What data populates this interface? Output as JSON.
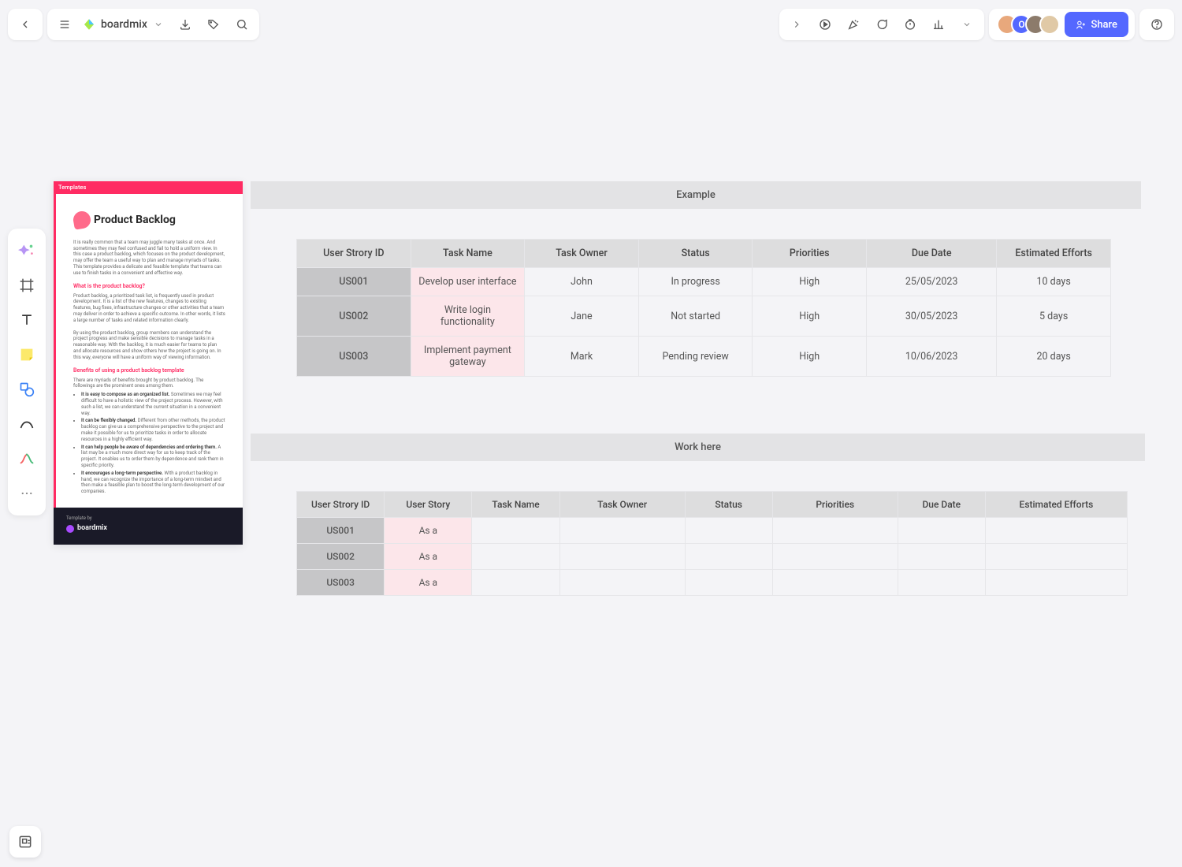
{
  "header": {
    "brand": "boardmix",
    "share": "Share"
  },
  "template": {
    "tag": "Templates",
    "title": "Product Backlog",
    "intro": "It is really common that a team may juggle many tasks at once. And sometimes they may feel confused and fail to hold a uniform view. In this case a product backlog, which focuses on the product development, may offer the team a useful way to plan and manage myriads of tasks. This template provides a delicate and feasible template that teams can use to finish tasks in a convenient and effective way.",
    "h1": "What is the product backlog?",
    "p1": "Product backlog, a prioritized task list, is frequently used in product development. It is a list of the new features, changes to existing features, bug fixes, infrastructure changes or other activities that a team may deliver in order to achieve a specific outcome. In other words, it lists a large number of tasks and related information clearly.",
    "p2": "By using the product backlog, group members can understand the project progress and make sensible decisions to manage tasks in a reasonable way. With the backlog, it is much easier for teams to plan and allocate resources and show others how the project is going on. In this way, everyone will have a uniform way of viewing information.",
    "h2": "Benefits of using a product backlog template",
    "p3": "There are myriads of benefits brought by product backlog. The followings are the prominent ones among them.",
    "li1b": "It is easy to compose as an organized list.",
    "li1": " Sometimes we may feel difficult to have a holistic view of the project process. However, with such a list, we can understand the current situation in a convenient way.",
    "li2b": "It can be flexibly changed.",
    "li2": " Different from other methods, the product backlog can give us a comprehensive perspective to the project and make it possible for us to prioritize tasks in order to allocate resources in a highly efficient way.",
    "li3b": "It can help people be aware of dependencies and ordering them.",
    "li3": " A list may be a much more direct way for us to keep track of the project. It enables us to order them by dependence and rank them in specific priority.",
    "li4b": "It encourages a long-term perspective.",
    "li4": " With a product backlog in hand, we can recognize the importance of a long-term mindset and then make a feasible plan to boost the long-term development of our companies.",
    "footer_by": "Template by",
    "footer_brand": "boardmix"
  },
  "example": {
    "title": "Example",
    "headers": [
      "User Strory ID",
      "Task Name",
      "Task Owner",
      "Status",
      "Priorities",
      "Due Date",
      "Estimated Efforts"
    ],
    "rows": [
      {
        "id": "US001",
        "task": "Develop user interface",
        "owner": "John",
        "status": "In progress",
        "prio": "High",
        "due": "25/05/2023",
        "eff": "10 days"
      },
      {
        "id": "US002",
        "task": "Write login functionality",
        "owner": "Jane",
        "status": "Not started",
        "prio": "High",
        "due": "30/05/2023",
        "eff": "5 days"
      },
      {
        "id": "US003",
        "task": "Implement payment gateway",
        "owner": "Mark",
        "status": "Pending review",
        "prio": "High",
        "due": "10/06/2023",
        "eff": "20 days"
      }
    ]
  },
  "work": {
    "title": "Work here",
    "headers": [
      "User Strory ID",
      "User Story",
      "Task Name",
      "Task Owner",
      "Status",
      "Priorities",
      "Due Date",
      "Estimated Efforts"
    ],
    "rows": [
      {
        "id": "US001",
        "story": "As a"
      },
      {
        "id": "US002",
        "story": "As a"
      },
      {
        "id": "US003",
        "story": "As a"
      }
    ]
  }
}
